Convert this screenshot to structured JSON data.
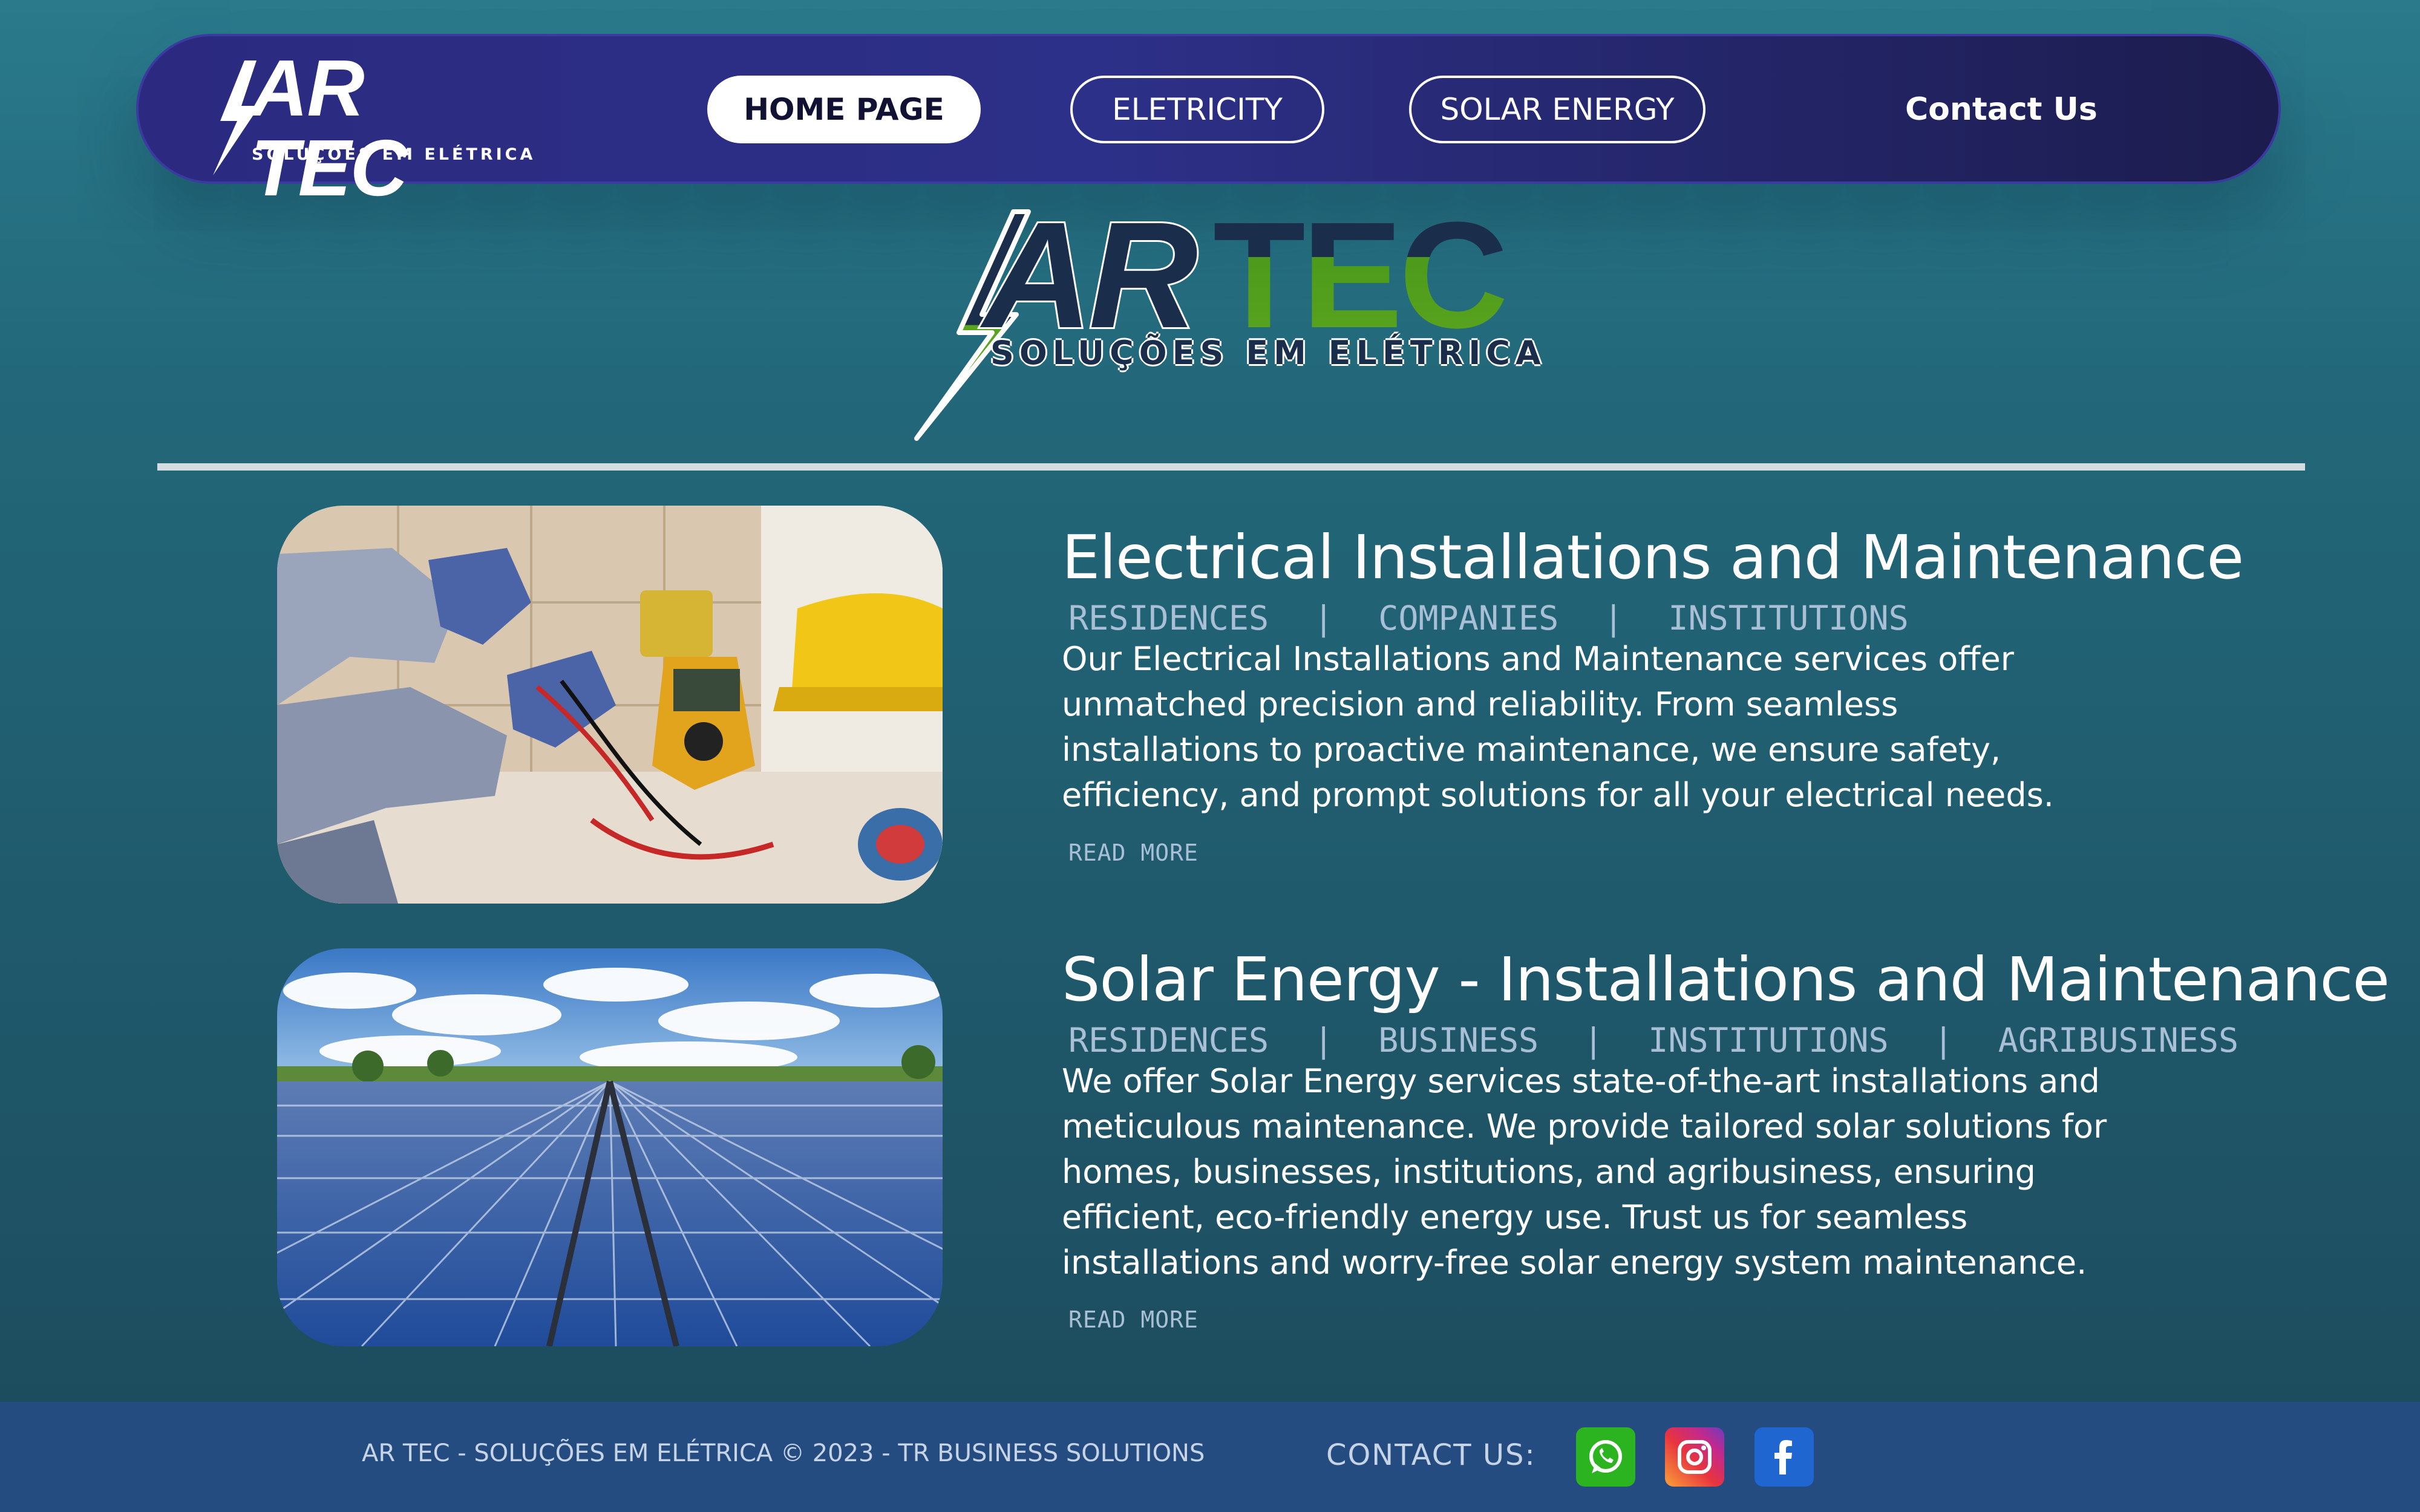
{
  "nav": {
    "logo_brand": "AR TEC",
    "logo_tagline": "SOLUÇÕES EM ELÉTRICA",
    "items": [
      {
        "label": "HOME PAGE",
        "active": true
      },
      {
        "label": "ELETRICITY",
        "active": false
      },
      {
        "label": "SOLAR ENERGY",
        "active": false
      }
    ],
    "contact_label": "Contact Us"
  },
  "hero": {
    "brand_part1": "AR",
    "brand_part2": "TEC",
    "tagline": "SOLUÇÕES EM ELÉTRICA"
  },
  "services": [
    {
      "title": "Electrical Installations and Maintenance",
      "tags": [
        "RESIDENCES",
        "COMPANIES",
        "INSTITUTIONS"
      ],
      "description": "Our Electrical Installations and Maintenance services offer unmatched precision and reliability. From seamless installations to proactive maintenance, we ensure safety, efficiency, and prompt solutions for all your electrical needs.",
      "read_more": "READ MORE",
      "image": "electrician-with-multimeter"
    },
    {
      "title": "Solar Energy - Installations and Maintenance",
      "tags": [
        "RESIDENCES",
        "BUSINESS",
        "INSTITUTIONS",
        "AGRIBUSINESS"
      ],
      "description": "We offer Solar Energy services state-of-the-art installations and meticulous maintenance. We provide tailored solar solutions for homes, businesses, institutions, and agribusiness, ensuring efficient, eco-friendly energy use. Trust us for seamless installations and worry-free solar energy system maintenance.",
      "read_more": "READ MORE",
      "image": "solar-panel-field"
    }
  ],
  "footer": {
    "copyright": "AR TEC - SOLUÇÕES EM ELÉTRICA © 2023 - TR BUSINESS SOLUTIONS",
    "contact_label": "CONTACT US:",
    "social": [
      "whatsapp-icon",
      "instagram-icon",
      "facebook-icon"
    ]
  },
  "colors": {
    "nav_bg": "#2d3088",
    "brand_navy": "#1a2d4a",
    "brand_green": "#5aa51e",
    "footer_bg": "#254c80",
    "tag_color": "#a8bfd6"
  }
}
